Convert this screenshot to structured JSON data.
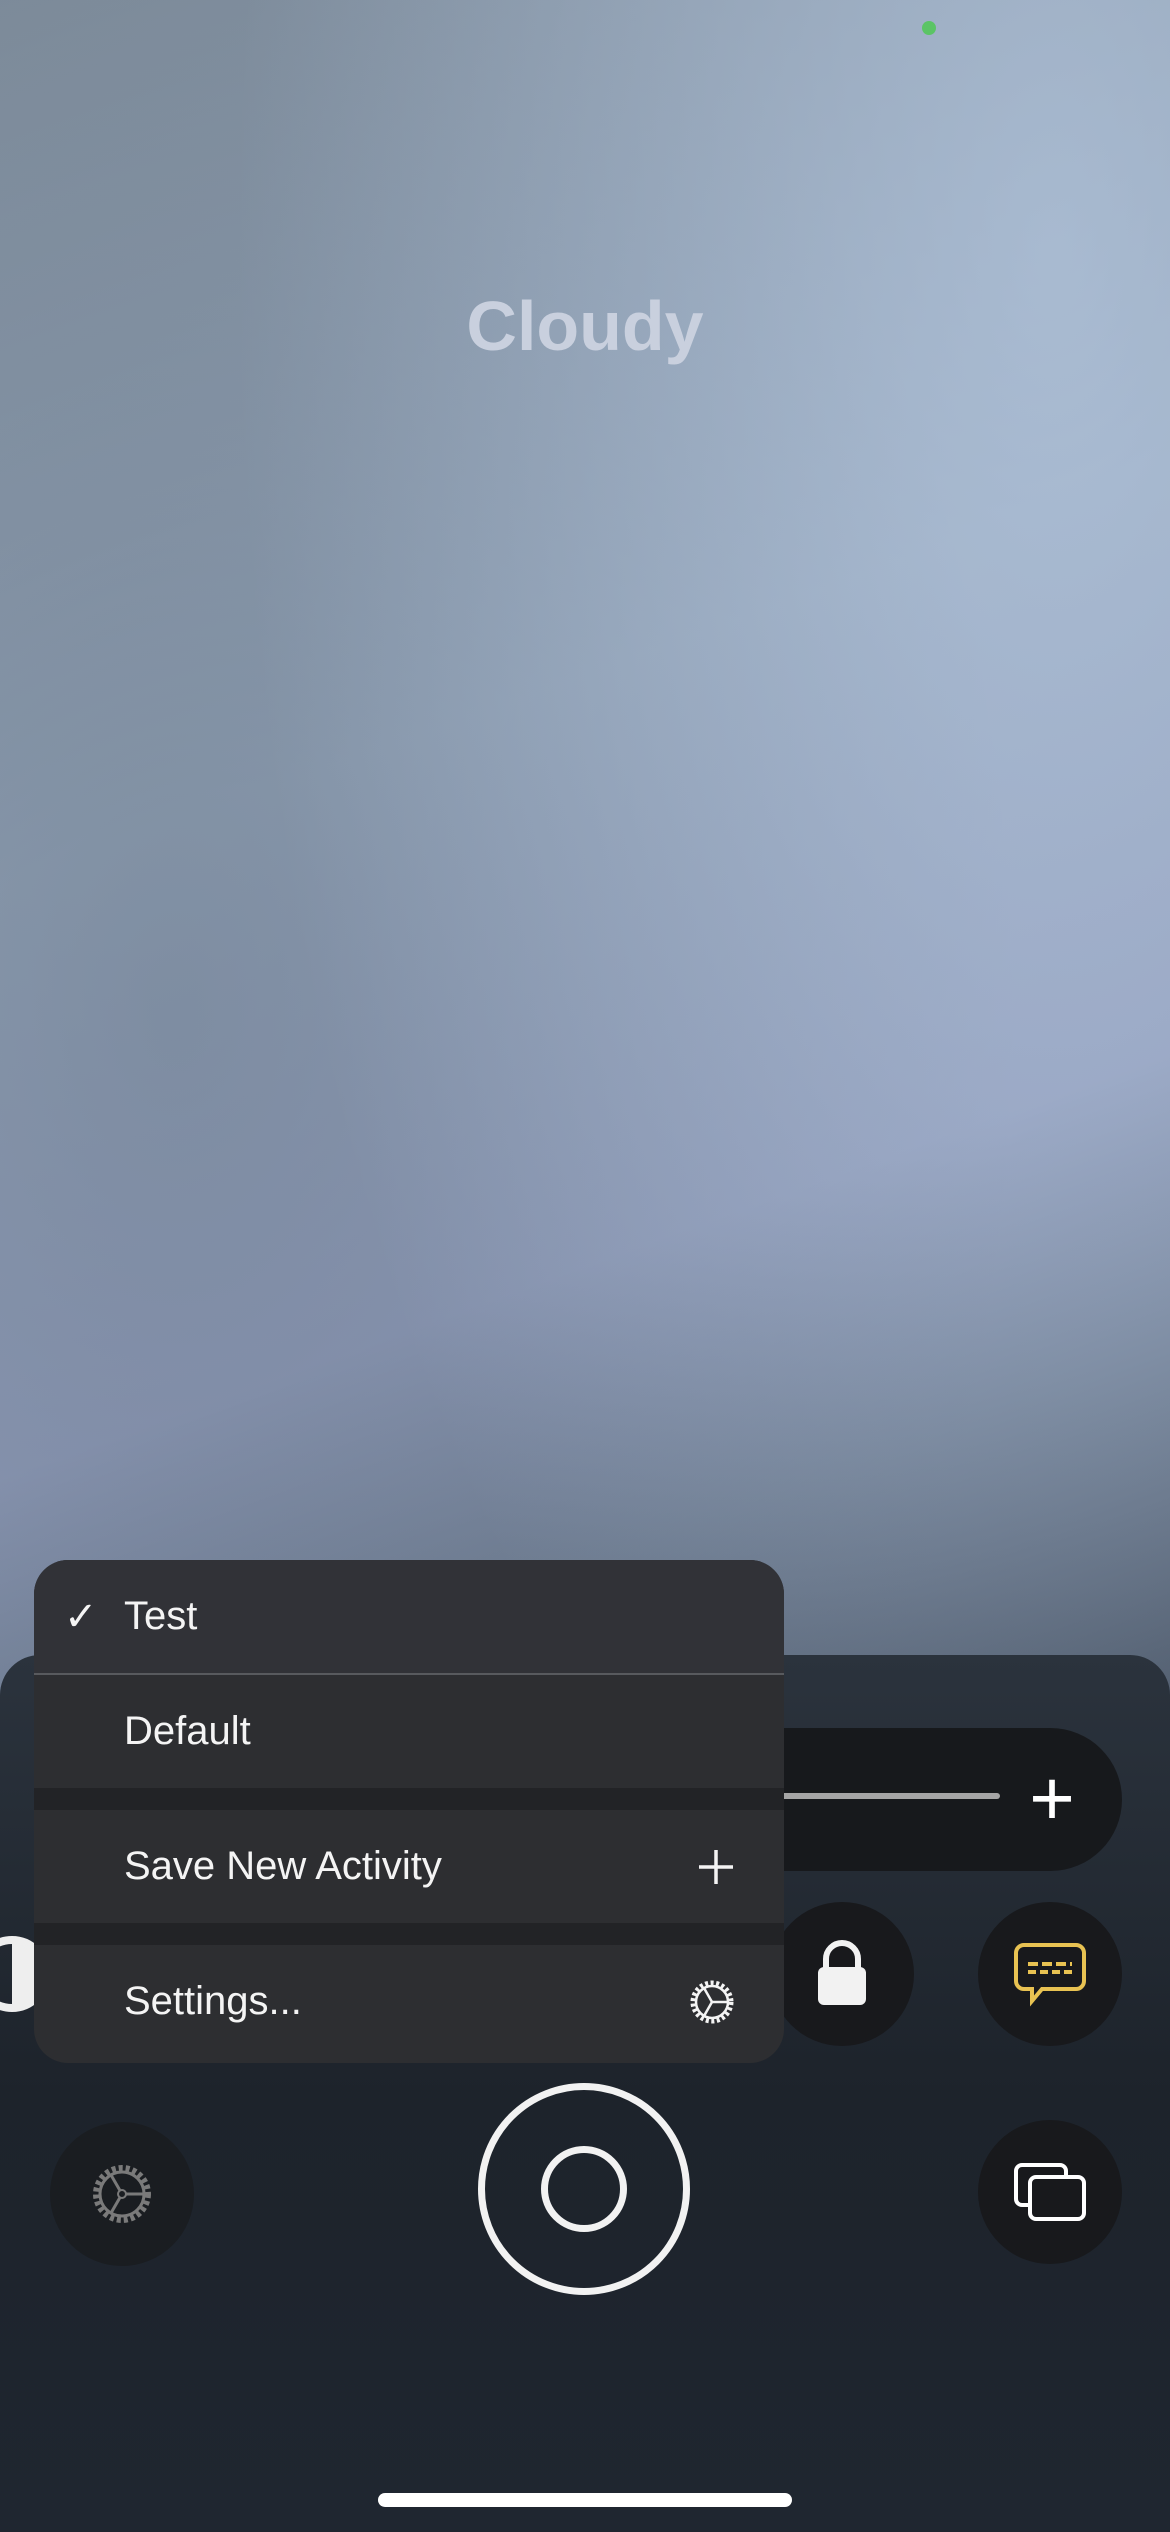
{
  "status": {
    "indicator_color": "#5bc465"
  },
  "scene": {
    "title": "Cloudy"
  },
  "menu": {
    "items": [
      {
        "label": "Test",
        "selected": true,
        "check_glyph": "✓"
      },
      {
        "label": "Default",
        "selected": false
      },
      {
        "label": "Save New Activity",
        "trailing_icon": "plus-icon",
        "trailing_glyph": "+"
      },
      {
        "label": "Settings...",
        "trailing_icon": "gear-icon"
      }
    ]
  },
  "controls": {
    "slider": {
      "plus_glyph": "+"
    },
    "caption_color": "#e8c252"
  }
}
